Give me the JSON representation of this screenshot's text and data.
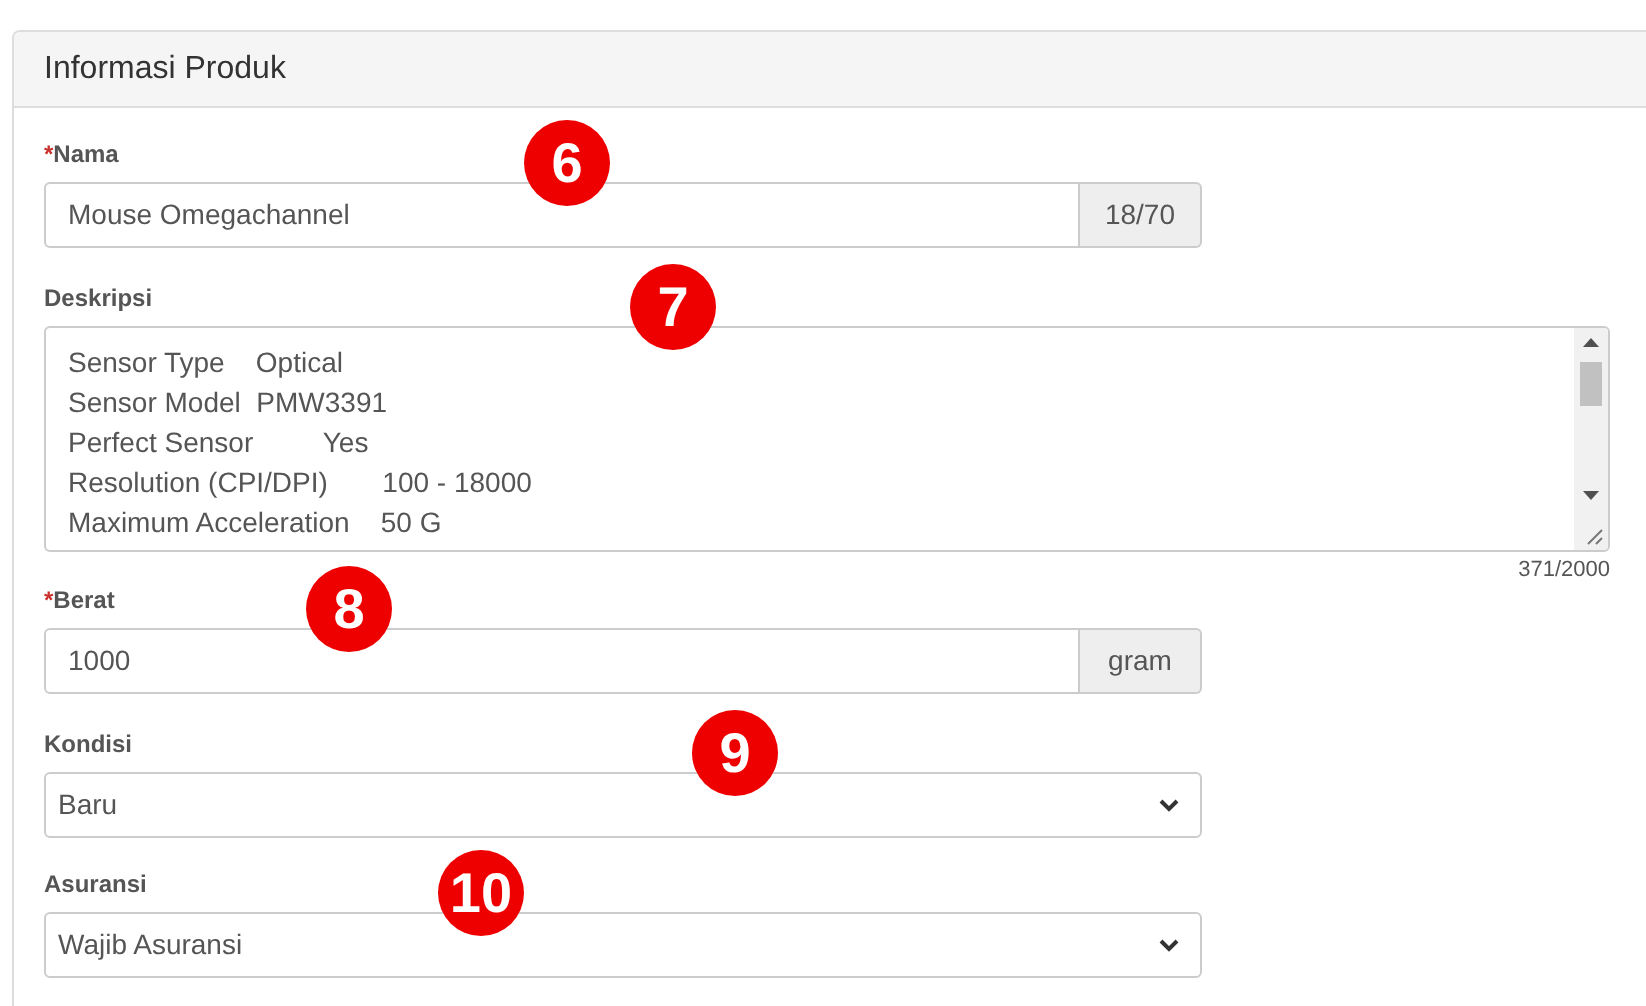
{
  "panel": {
    "title": "Informasi Produk"
  },
  "fields": [
    {
      "kind": "input",
      "label": "Nama",
      "required_mark": "*",
      "value": "Mouse Omegachannel",
      "addon": "18/70",
      "annotation": "6"
    },
    {
      "kind": "textarea",
      "label": "Deskripsi",
      "lines": [
        "Sensor Type    Optical",
        "Sensor Model  PMW3391",
        "Perfect Sensor         Yes",
        "Resolution (CPI/DPI)       100 - 18000",
        "Maximum Acceleration    50 G"
      ],
      "counter": "371/2000",
      "annotation": "7"
    },
    {
      "kind": "input",
      "label": "Berat",
      "required_mark": "*",
      "value": "1000",
      "addon": "gram",
      "annotation": "8"
    },
    {
      "kind": "select",
      "label": "Kondisi",
      "value": "Baru",
      "annotation": "9"
    },
    {
      "kind": "select",
      "label": "Asuransi",
      "value": "Wajib Asuransi",
      "annotation": "10"
    }
  ]
}
